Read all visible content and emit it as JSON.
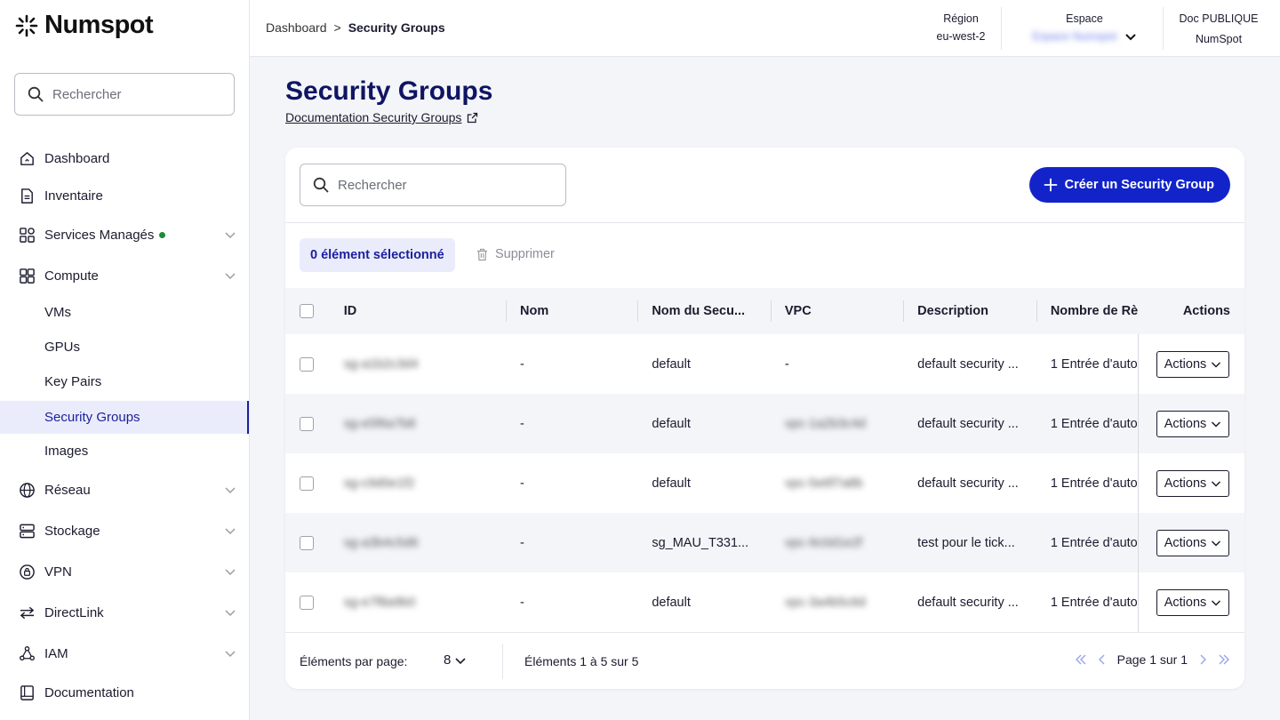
{
  "brand": {
    "name": "Numspot"
  },
  "sidebar": {
    "search_placeholder": "Rechercher",
    "items": [
      {
        "label": "Dashboard",
        "icon": "home-icon"
      },
      {
        "label": "Inventaire",
        "icon": "document-icon"
      },
      {
        "label": "Services Managés",
        "icon": "grid-icon",
        "status": "online"
      },
      {
        "label": "Compute",
        "icon": "compute-icon"
      },
      {
        "label": "VMs"
      },
      {
        "label": "GPUs"
      },
      {
        "label": "Key Pairs"
      },
      {
        "label": "Security Groups",
        "active": true
      },
      {
        "label": "Images"
      },
      {
        "label": "Réseau",
        "icon": "globe-icon"
      },
      {
        "label": "Stockage",
        "icon": "storage-icon"
      },
      {
        "label": "VPN",
        "icon": "vpn-icon"
      },
      {
        "label": "DirectLink",
        "icon": "directlink-icon"
      },
      {
        "label": "IAM",
        "icon": "iam-icon"
      },
      {
        "label": "Documentation",
        "icon": "book-icon"
      }
    ]
  },
  "header": {
    "breadcrumb_root": "Dashboard",
    "breadcrumb_sep": ">",
    "breadcrumb_current": "Security Groups",
    "region_label": "Région",
    "region_value": "eu-west-2",
    "space_label": "Espace",
    "space_value": "Espace Numspot",
    "doc_label": "Doc PUBLIQUE",
    "doc_value": "NumSpot"
  },
  "page": {
    "title": "Security Groups",
    "doc_link": "Documentation Security Groups"
  },
  "toolbar": {
    "search_placeholder": "Rechercher",
    "create_label": "Créer un Security Group",
    "selected_label": "0 élément sélectionné",
    "delete_label": "Supprimer"
  },
  "table": {
    "columns": [
      "ID",
      "Nom",
      "Nom du Secu...",
      "VPC",
      "Description",
      "Nombre de Rè",
      "Actions"
    ],
    "rows": [
      {
        "id": "sg-a1b2c3d4",
        "nom": "-",
        "sg_name": "default",
        "vpc": "-",
        "vpc_blurred": false,
        "description": "default security ...",
        "rules": "1 Entrée d'auto",
        "action": "Actions"
      },
      {
        "id": "sg-e5f6a7b8",
        "nom": "-",
        "sg_name": "default",
        "vpc": "vpc-1a2b3c4d",
        "vpc_blurred": true,
        "description": "default security ...",
        "rules": "1 Entrée d'auto",
        "action": "Actions"
      },
      {
        "id": "sg-c9d0e1f2",
        "nom": "-",
        "sg_name": "default",
        "vpc": "vpc-5e6f7a8b",
        "vpc_blurred": true,
        "description": "default security ...",
        "rules": "1 Entrée d'auto",
        "action": "Actions"
      },
      {
        "id": "sg-a3b4c5d6",
        "nom": "-",
        "sg_name": "sg_MAU_T331...",
        "vpc": "vpc-9c0d1e2f",
        "vpc_blurred": true,
        "description": "test pour le tick...",
        "rules": "1 Entrée d'auto",
        "action": "Actions"
      },
      {
        "id": "sg-e7f8a9b0",
        "nom": "-",
        "sg_name": "default",
        "vpc": "vpc-3a4b5c6d",
        "vpc_blurred": true,
        "description": "default security ...",
        "rules": "1 Entrée d'auto",
        "action": "Actions"
      }
    ]
  },
  "footer": {
    "per_page_label": "Éléments par page:",
    "per_page_value": "8",
    "range_label": "Éléments 1 à 5 sur 5",
    "page_label": "Page 1 sur 1"
  },
  "colors": {
    "primary": "#1224c9",
    "title": "#0f1463",
    "active_bg": "#eaecfb",
    "status_green": "#1d8a3a"
  }
}
